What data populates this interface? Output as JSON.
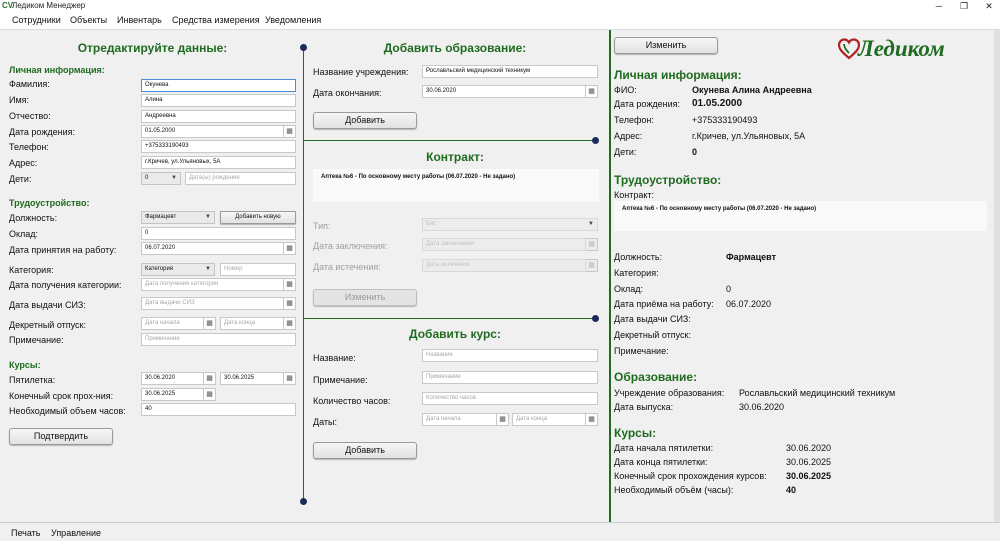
{
  "window": {
    "app_icon": "CV",
    "title": "Ледиком Менеджер"
  },
  "menu": [
    "Сотрудники",
    "Объекты",
    "Инвентарь",
    "Средства измерения",
    "Уведомления"
  ],
  "status": [
    "Печать",
    "Управление"
  ],
  "left": {
    "title": "Отредактируйте данные:",
    "personal": {
      "title": "Личная информация:",
      "surname_label": "Фамилия:",
      "surname": "Окунева",
      "name_label": "Имя:",
      "name": "Алина",
      "patronymic_label": "Отчество:",
      "patronymic": "Андреевна",
      "birth_label": "Дата рождения:",
      "birth": "01.05.2000",
      "phone_label": "Телефон:",
      "phone": "+375333190493",
      "address_label": "Адрес:",
      "address": "г.Кричев, ул.Ульяновых, 5А",
      "children_label": "Дети:",
      "children": "0",
      "children_birth_ph": "Дата(ы) рождения"
    },
    "employment": {
      "title": "Трудоустройство:",
      "position_label": "Должность:",
      "position": "Фармацевт",
      "add_new": "Добавить новую",
      "rate_label": "Оклад:",
      "rate": "0",
      "hire_label": "Дата принятия на работу:",
      "hire": "06.07.2020",
      "category_label": "Категория:",
      "category": "Категория",
      "number_ph": "Номер",
      "cat_date_label": "Дата получения категории:",
      "cat_date_ph": "Дата получения категории",
      "siz_label": "Дата выдачи СИЗ:",
      "siz_ph": "Дата выдачи СИЗ",
      "maternity_label": "Декретный отпуск:",
      "start_ph": "Дата начала",
      "end_ph": "Дата конца",
      "note_label": "Примечание:",
      "note_ph": "Примечание"
    },
    "courses": {
      "title": "Курсы:",
      "five_label": "Пятилетка:",
      "five_start": "30.06.2020",
      "five_end": "30.06.2025",
      "deadline_label": "Конечный срок прох-ния:",
      "deadline": "30.06.2025",
      "hours_label": "Необходимый объем часов:",
      "hours": "40"
    },
    "confirm": "Подтвердить"
  },
  "middle": {
    "education": {
      "title": "Добавить образование:",
      "inst_label": "Название учреждения:",
      "inst": "Рославльский медицинский техникум",
      "end_label": "Дата окончания:",
      "end": "30.06.2020",
      "add": "Добавить"
    },
    "contract": {
      "title": "Контракт:",
      "row": "Аптека №6 - По основному месту работы (06.07.2020 - Не задано)",
      "type_label": "Тип:",
      "type": "Бес",
      "conc_label": "Дата заключения:",
      "conc_ph": "Дата заключения",
      "exp_label": "Дата истечения:",
      "exp_ph": "Дата истечения",
      "change": "Изменить"
    },
    "course": {
      "title": "Добавить курс:",
      "name_label": "Название:",
      "name_ph": "Название",
      "note_label": "Примечание:",
      "note_ph": "Примечание",
      "hours_label": "Количество часов:",
      "hours_ph": "Количество часов",
      "dates_label": "Даты:",
      "start_ph": "Дата начала",
      "end_ph": "Дата конца",
      "add": "Добавить"
    }
  },
  "right": {
    "change": "Изменить",
    "logo": "Ледиком",
    "personal": {
      "title": "Личная информация:",
      "fio_label": "ФИО:",
      "fio": "Окунева Алина Андреевна",
      "birth_label": "Дата рождения:",
      "birth": "01.05.2000",
      "phone_label": "Телефон:",
      "phone": "+375333190493",
      "address_label": "Адрес:",
      "address": "г.Кричев, ул.Ульяновых, 5А",
      "children_label": "Дети:",
      "children": "0"
    },
    "employment": {
      "title": "Трудоустройство:",
      "contract_label": "Контракт:",
      "contract_row": "Аптека №6 - По основному месту работы (06.07.2020 - Не задано)",
      "position_label": "Должность:",
      "position": "Фармацевт",
      "category_label": "Категория:",
      "rate_label": "Оклад:",
      "rate": "0",
      "hire_label": "Дата приёма на работу:",
      "hire": "06.07.2020",
      "siz_label": "Дата выдачи СИЗ:",
      "maternity_label": "Декретный отпуск:",
      "note_label": "Примечание:"
    },
    "education": {
      "title": "Образование:",
      "inst_label": "Учреждение образования:",
      "inst": "Рославльский медицинский техникум",
      "date_label": "Дата выпуска:",
      "date": "30.06.2020"
    },
    "courses": {
      "title": "Курсы:",
      "start_label": "Дата начала пятилетки:",
      "start": "30.06.2020",
      "end_label": "Дата конца пятилетки:",
      "end": "30.06.2025",
      "deadline_label": "Конечный срок прохождения курсов:",
      "deadline": "30.06.2025",
      "hours_label": "Необходимый объём (часы):",
      "hours": "40"
    }
  },
  "colors": {
    "accent_green": "#1f6b1f",
    "logo_red": "#b22222",
    "dot": "#1a2a5a"
  }
}
